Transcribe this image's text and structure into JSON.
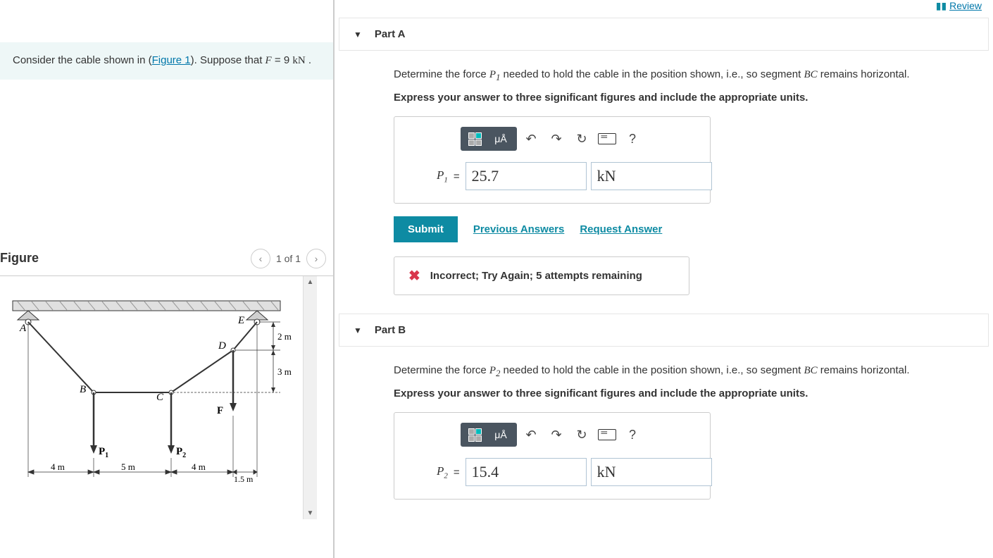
{
  "review_label": "Review",
  "problem": {
    "text_before_link": "Consider the cable shown in (",
    "link_text": "Figure 1",
    "text_after_link": "). Suppose that ",
    "var": "F",
    "eq": " = 9 ",
    "unit": "kN",
    "end": " ."
  },
  "figure": {
    "title": "Figure",
    "count": "1 of 1",
    "labels": {
      "A": "A",
      "B": "B",
      "C": "C",
      "D": "D",
      "E": "E",
      "F": "F",
      "P1": "P",
      "P1sub": "1",
      "P2": "P",
      "P2sub": "2",
      "d4m": "4 m",
      "d5m": "5 m",
      "d4m2": "4 m",
      "d15m": "1.5 m",
      "d2m": "2 m",
      "d3m": "3 m"
    }
  },
  "partA": {
    "title": "Part A",
    "instr_pre": "Determine the force ",
    "var": "P",
    "sub": "1",
    "instr_mid": " needed to hold the cable in the position shown, i.e., so segment ",
    "seg": "BC",
    "instr_post": " remains horizontal.",
    "instr_bold": "Express your answer to three significant figures and include the appropriate units.",
    "var_label": "P",
    "var_sub": "1",
    "value": "25.7",
    "unit": "kN",
    "submit": "Submit",
    "prev": "Previous Answers",
    "request": "Request Answer",
    "feedback": "Incorrect; Try Again; 5 attempts remaining"
  },
  "partB": {
    "title": "Part B",
    "instr_pre": "Determine the force ",
    "var": "P",
    "sub": "2",
    "instr_mid": " needed to hold the cable in the position shown, i.e., so segment ",
    "seg": "BC",
    "instr_post": " remains horizontal.",
    "instr_bold": "Express your answer to three significant figures and include the appropriate units.",
    "var_label": "P",
    "var_sub": "2",
    "value": "15.4",
    "unit": "kN"
  },
  "toolbar": {
    "ua": "μÅ",
    "help": "?"
  }
}
